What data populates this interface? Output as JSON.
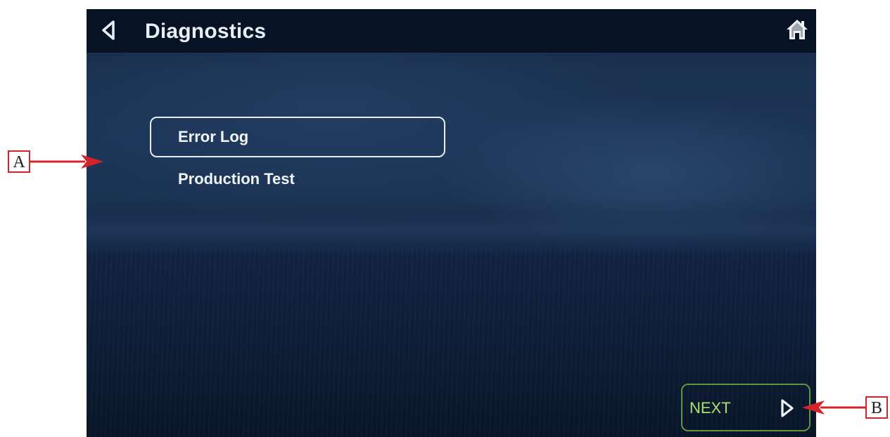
{
  "header": {
    "title": "Diagnostics",
    "back_icon": "chevron-left-outline-icon",
    "home_icon": "home-icon"
  },
  "menu": {
    "items": [
      {
        "label": "Error Log",
        "selected": true
      },
      {
        "label": "Production Test",
        "selected": false
      }
    ]
  },
  "footer": {
    "next_label": "NEXT",
    "next_icon": "chevron-right-outline-icon",
    "accent_color": "#a7e06e"
  },
  "callouts": {
    "a": "A",
    "b": "B",
    "color": "#d4232a"
  }
}
